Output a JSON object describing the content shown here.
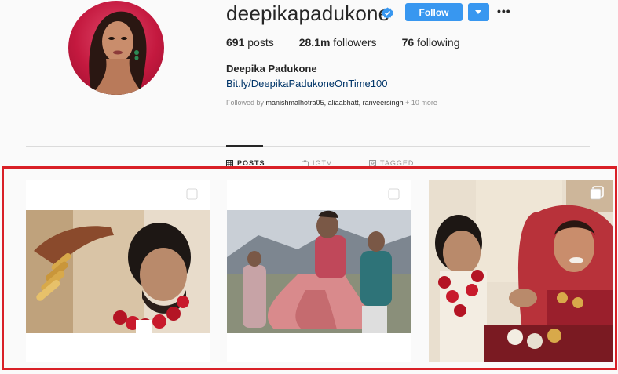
{
  "profile": {
    "username": "deepikapadukone",
    "follow_label": "Follow",
    "more_label": "•••",
    "stats": {
      "posts_count": "691",
      "posts_label": " posts",
      "followers_count": "28.1m",
      "followers_label": " followers",
      "following_count": "76",
      "following_label": " following"
    },
    "full_name": "Deepika Padukone",
    "bio_link": "Bit.ly/DeepikaPadukoneOnTime100",
    "followed_by_prefix": "Followed by ",
    "followed_by_names": "manishmalhotra05, aliaabhatt, ranveersingh",
    "followed_by_more": " + 10 more"
  },
  "tabs": [
    {
      "label": "POSTS",
      "active": true
    },
    {
      "label": "IGTV",
      "active": false
    },
    {
      "label": "TAGGED",
      "active": false
    }
  ],
  "colors": {
    "follow_blue": "#3897f0",
    "highlight_red": "#d92027",
    "link_blue": "#003569",
    "verified_blue": "#3897f0"
  },
  "icons": [
    "verified-badge-icon",
    "chevron-down-icon",
    "more-dots-icon",
    "grid-icon",
    "igtv-icon",
    "tagged-icon",
    "multiple-photos-icon"
  ]
}
